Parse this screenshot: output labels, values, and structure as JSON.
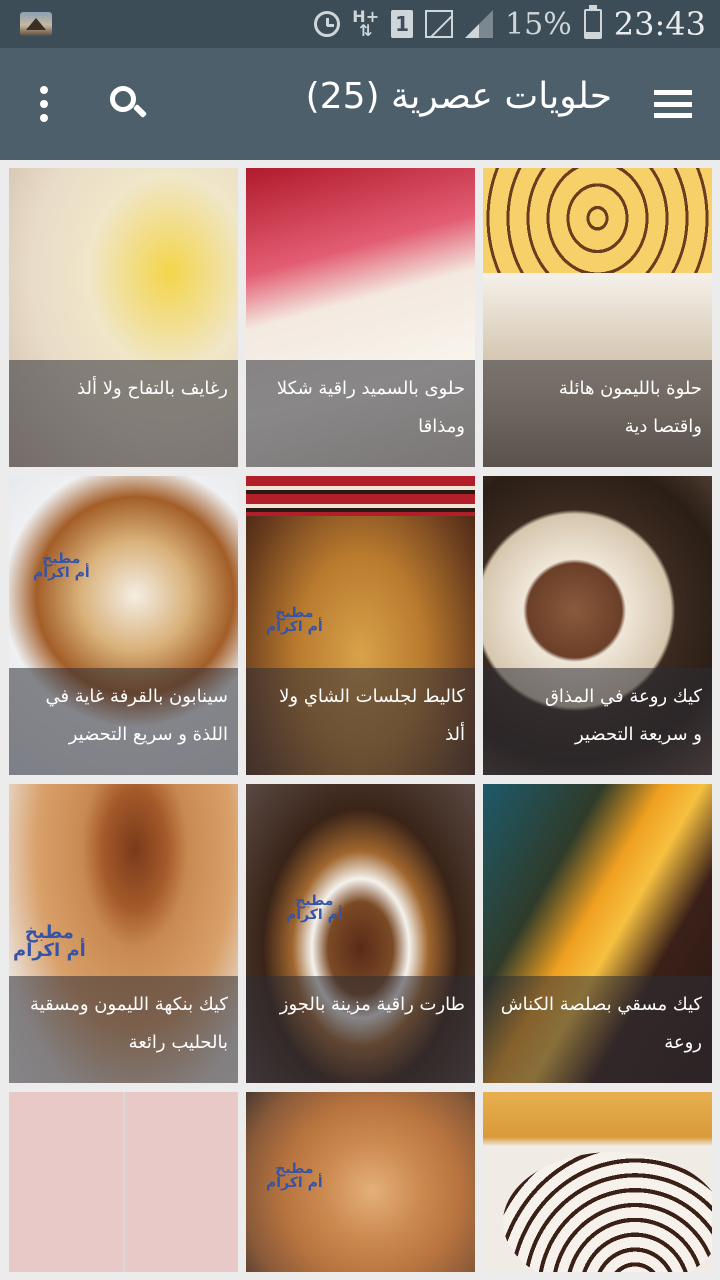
{
  "status_bar": {
    "network": "H+",
    "sim_slot": "1",
    "battery_percent": "15%",
    "time": "23:43"
  },
  "app_bar": {
    "title": "حلويات عصرية (25)",
    "icons": [
      "more-vert-icon",
      "search-icon",
      "hamburger-menu-icon"
    ]
  },
  "watermark_text": "مطبخ أم اكرام",
  "recipes": [
    {
      "line1": "حلوة بالليمون هائلة",
      "line2": "واقتصا دية"
    },
    {
      "line1": "حلوى بالسميد راقية  شكلا",
      "line2": "ومذاقا"
    },
    {
      "line1": "رغايف  بالتفاح ولا ألذ",
      "line2": ""
    },
    {
      "line1": "كيك روعة في المذاق",
      "line2": "و سريعة التحضير"
    },
    {
      "line1": "كاليط لجلسات الشاي ولا",
      "line2": "ألذ"
    },
    {
      "line1": "سينابون بالقرفة غاية في",
      "line2": "اللذة و سريع التحضير"
    },
    {
      "line1": "كيك مسقي بصلصة الكناش",
      "line2": "روعة"
    },
    {
      "line1": "طارت راقية مزينة بالجوز",
      "line2": ""
    },
    {
      "line1": "كيك بنكهة الليمون ومسقية",
      "line2": "بالحليب رائعة"
    },
    {
      "line1": "",
      "line2": ""
    },
    {
      "line1": "",
      "line2": ""
    },
    {
      "line1": "",
      "line2": ""
    }
  ]
}
